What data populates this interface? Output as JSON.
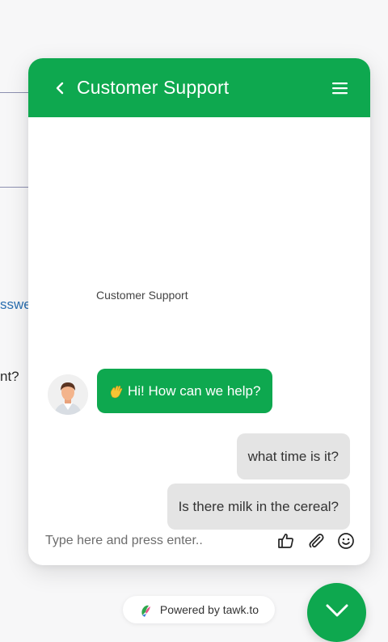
{
  "background_page": {
    "fragment_1": "sswe",
    "fragment_2": "nt?"
  },
  "widget": {
    "title": "Customer Support",
    "agent_name": "Customer Support",
    "messages": [
      {
        "from": "agent",
        "text": "Hi! How can we help?"
      },
      {
        "from": "user",
        "text": "what time is it?"
      },
      {
        "from": "user",
        "text": "Is there milk in the cereal?"
      }
    ],
    "composer": {
      "placeholder": "Type here and press enter.."
    },
    "icons": [
      "back-icon",
      "menu-icon",
      "wave-icon",
      "thumbs-up-icon",
      "paperclip-icon",
      "emoji-icon",
      "chevron-down-icon"
    ]
  },
  "powered_by": "Powered by tawk.to",
  "colors": {
    "accent": "#0ea84f",
    "user_bubble": "#e4e4e4"
  }
}
